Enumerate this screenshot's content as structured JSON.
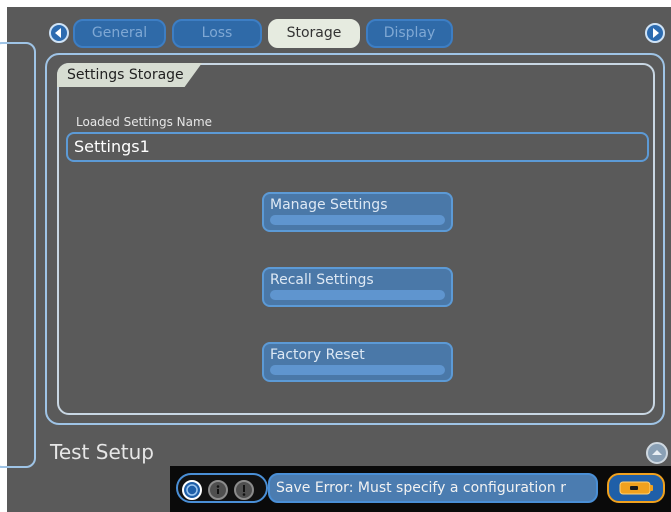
{
  "tabs": [
    {
      "label": "General",
      "active": false
    },
    {
      "label": "Loss",
      "active": false
    },
    {
      "label": "Storage",
      "active": true
    },
    {
      "label": "Display",
      "active": false
    }
  ],
  "nav": {
    "prev_icon": "chevron-left-icon",
    "next_icon": "chevron-right-icon"
  },
  "section": {
    "title": "Settings Storage",
    "loaded_label": "Loaded Settings Name",
    "loaded_value": "Settings1"
  },
  "buttons": {
    "manage": "Manage Settings",
    "recall": "Recall Settings",
    "factory": "Factory Reset"
  },
  "footer": {
    "title": "Test Setup",
    "scroll_icon": "chevron-up-icon"
  },
  "status": {
    "message": "Save Error: Must specify a configuration r",
    "icons": [
      "status-circle-icon",
      "info-icon",
      "alert-icon"
    ],
    "battery_icon": "battery-icon"
  },
  "colors": {
    "background": "#5a5a5a",
    "accent": "#2f6aa8",
    "active_tab": "#e6ebe0",
    "battery_border": "#f0a11e"
  }
}
